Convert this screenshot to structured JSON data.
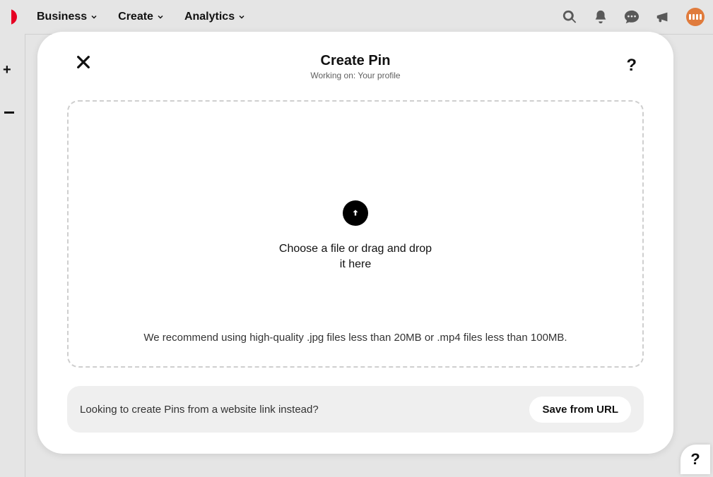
{
  "topbar": {
    "nav": [
      "Business",
      "Create",
      "Analytics"
    ]
  },
  "modal": {
    "title": "Create Pin",
    "subtitle": "Working on: Your profile",
    "drop_prompt": "Choose a file or drag and drop it here",
    "drop_hint": "We recommend using high-quality .jpg files less than 20MB or .mp4 files less than 100MB.",
    "url_prompt": "Looking to create Pins from a website link instead?",
    "save_url_label": "Save from URL"
  },
  "help": "?"
}
